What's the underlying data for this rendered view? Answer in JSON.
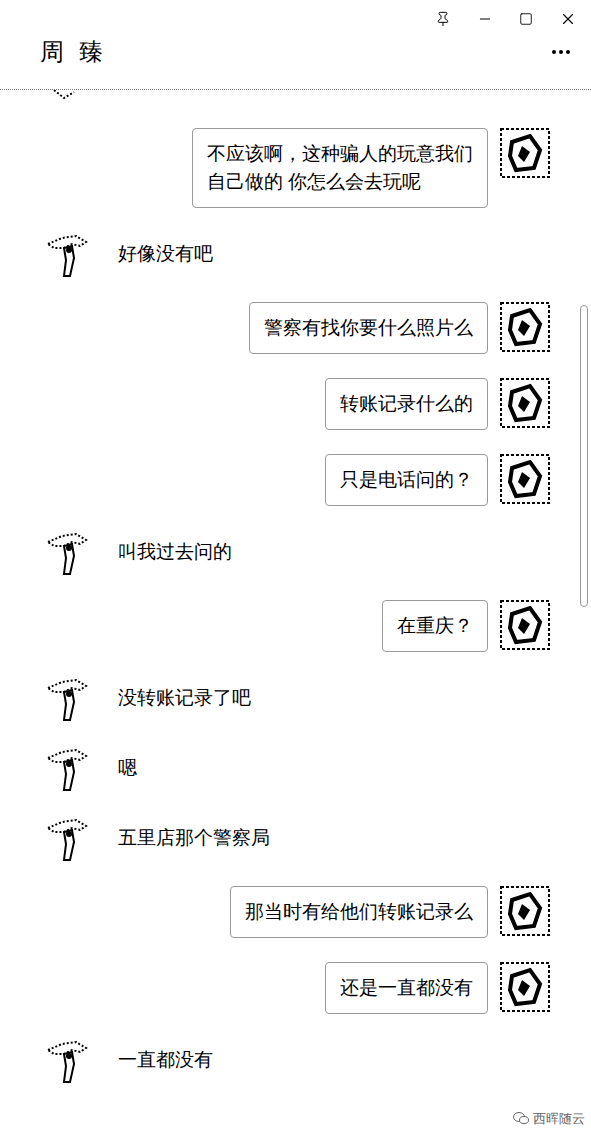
{
  "window": {
    "title": "周 臻"
  },
  "messages": [
    {
      "side": "outgoing",
      "text": "不应该啊，这种骗人的玩意我们\n自己做的 你怎么会去玩呢"
    },
    {
      "side": "incoming",
      "text": "好像没有吧"
    },
    {
      "side": "outgoing",
      "text": "警察有找你要什么照片么"
    },
    {
      "side": "outgoing",
      "text": "转账记录什么的"
    },
    {
      "side": "outgoing",
      "text": "只是电话问的？"
    },
    {
      "side": "incoming",
      "text": "叫我过去问的"
    },
    {
      "side": "outgoing",
      "text": "在重庆？"
    },
    {
      "side": "incoming",
      "text": "没转账记录了吧"
    },
    {
      "side": "incoming",
      "text": "嗯"
    },
    {
      "side": "incoming",
      "text": "五里店那个警察局"
    },
    {
      "side": "outgoing",
      "text": "那当时有给他们转账记录么"
    },
    {
      "side": "outgoing",
      "text": "还是一直都没有"
    },
    {
      "side": "incoming",
      "text": "一直都没有"
    }
  ],
  "watermark": {
    "text": "西晖随云"
  }
}
